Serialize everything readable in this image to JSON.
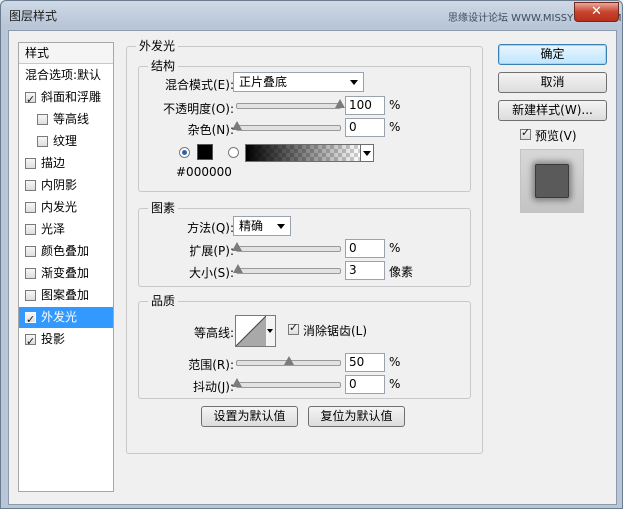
{
  "window": {
    "title": "图层样式",
    "watermark": "思缘设计论坛 WWW.MISSYUAN.COM",
    "close_glyph": "✕"
  },
  "sidebar": {
    "header": "样式",
    "items": [
      {
        "label": "混合选项:默认",
        "checkbox": false,
        "checked": false,
        "indent": false,
        "selected": false
      },
      {
        "label": "斜面和浮雕",
        "checkbox": true,
        "checked": true,
        "indent": false,
        "selected": false
      },
      {
        "label": "等高线",
        "checkbox": true,
        "checked": false,
        "indent": true,
        "selected": false
      },
      {
        "label": "纹理",
        "checkbox": true,
        "checked": false,
        "indent": true,
        "selected": false
      },
      {
        "label": "描边",
        "checkbox": true,
        "checked": false,
        "indent": false,
        "selected": false
      },
      {
        "label": "内阴影",
        "checkbox": true,
        "checked": false,
        "indent": false,
        "selected": false
      },
      {
        "label": "内发光",
        "checkbox": true,
        "checked": false,
        "indent": false,
        "selected": false
      },
      {
        "label": "光泽",
        "checkbox": true,
        "checked": false,
        "indent": false,
        "selected": false
      },
      {
        "label": "颜色叠加",
        "checkbox": true,
        "checked": false,
        "indent": false,
        "selected": false
      },
      {
        "label": "渐变叠加",
        "checkbox": true,
        "checked": false,
        "indent": false,
        "selected": false
      },
      {
        "label": "图案叠加",
        "checkbox": true,
        "checked": false,
        "indent": false,
        "selected": false
      },
      {
        "label": "外发光",
        "checkbox": true,
        "checked": true,
        "indent": false,
        "selected": true
      },
      {
        "label": "投影",
        "checkbox": true,
        "checked": true,
        "indent": false,
        "selected": false
      }
    ]
  },
  "panel": {
    "title": "外发光",
    "structure": {
      "title": "结构",
      "blend_mode_label": "混合模式(E):",
      "blend_mode_value": "正片叠底",
      "opacity_label": "不透明度(O):",
      "opacity_value": "100",
      "opacity_level": 100,
      "opacity_unit": "%",
      "noise_label": "杂色(N):",
      "noise_value": "0",
      "noise_level": 0,
      "noise_unit": "%",
      "color_hex": "#000000",
      "color_mode": "solid"
    },
    "elements": {
      "title": "图素",
      "method_label": "方法(Q):",
      "method_value": "精确",
      "spread_label": "扩展(P):",
      "spread_value": "0",
      "spread_level": 0,
      "spread_unit": "%",
      "size_label": "大小(S):",
      "size_value": "3",
      "size_level": 1.2,
      "size_unit": "像素"
    },
    "quality": {
      "title": "品质",
      "contour_label": "等高线:",
      "antialias_label": "消除锯齿(L)",
      "antialias_checked": true,
      "range_label": "范围(R):",
      "range_value": "50",
      "range_level": 50,
      "range_unit": "%",
      "jitter_label": "抖动(J):",
      "jitter_value": "0",
      "jitter_level": 0,
      "jitter_unit": "%"
    },
    "set_default_label": "设置为默认值",
    "reset_default_label": "复位为默认值"
  },
  "actions": {
    "ok_label": "确定",
    "cancel_label": "取消",
    "new_style_label": "新建样式(W)...",
    "preview_label": "预览(V)",
    "preview_checked": true
  },
  "colors": {
    "selection": "#3399ff",
    "glow": "#000000"
  }
}
